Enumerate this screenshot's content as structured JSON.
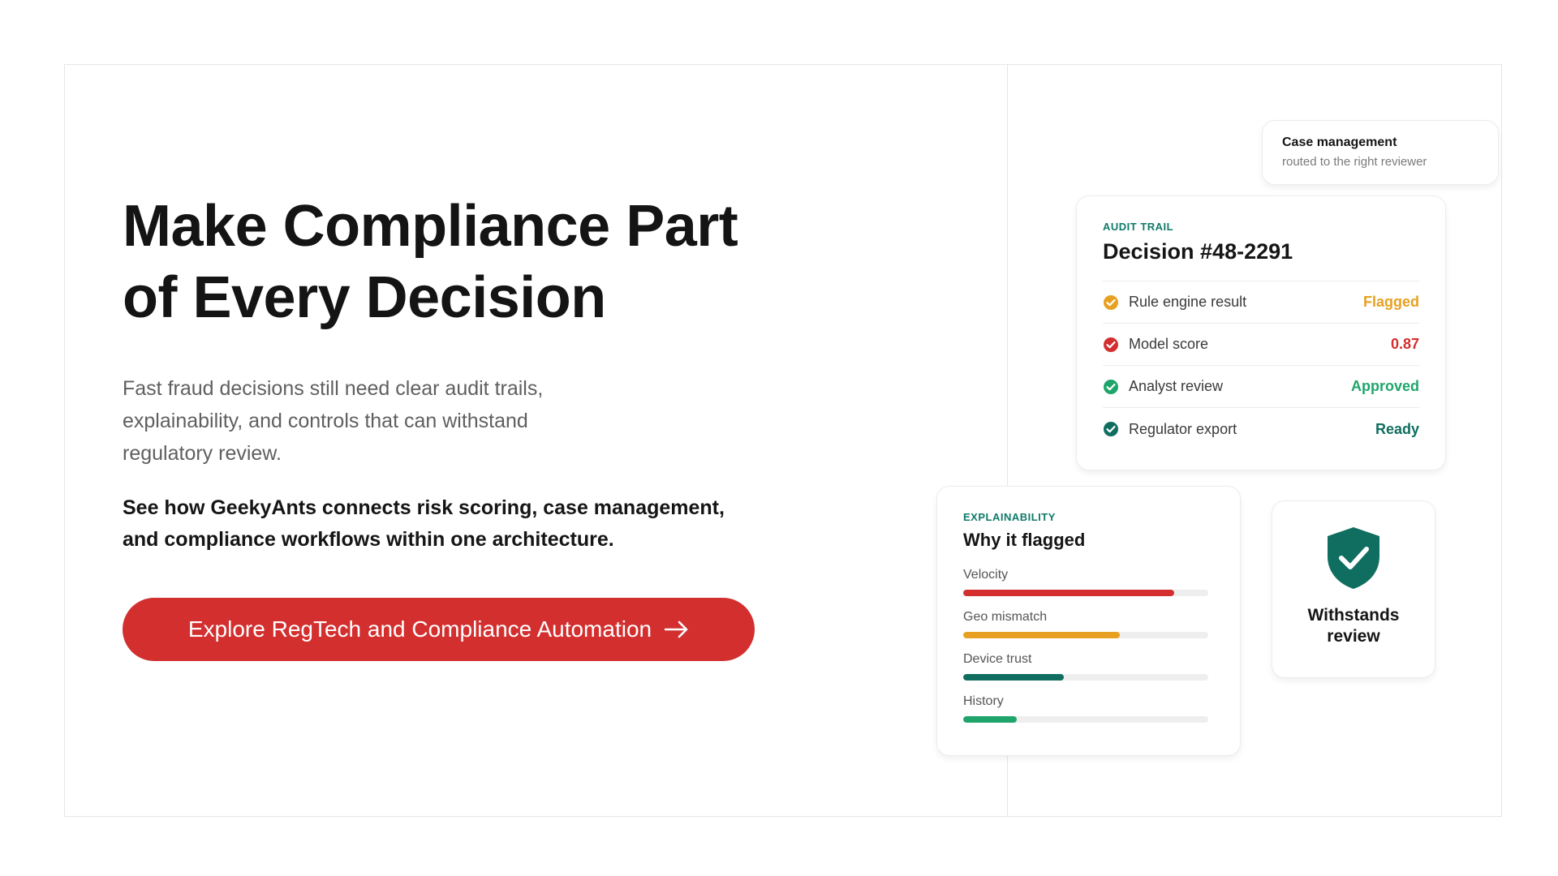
{
  "hero": {
    "title_line1": "Make Compliance Part",
    "title_line2": "of Every Decision",
    "description": "Fast fraud decisions still need clear audit trails, explainability, and controls that can withstand regulatory review.",
    "cta_text": "See how GeekyAnts connects risk scoring, case management, and compliance workflows within one architecture.",
    "button_label": "Explore RegTech and Compliance Automation",
    "button_color": "#d32f2f"
  },
  "case_card": {
    "title": "Case management",
    "subtitle": "routed to the right reviewer"
  },
  "audit_card": {
    "label": "AUDIT TRAIL",
    "title": "Decision #48-2291",
    "rows": [
      {
        "label": "Rule engine result",
        "value": "Flagged",
        "color": "#e8a020",
        "icon": "check-circle-icon"
      },
      {
        "label": "Model score",
        "value": "0.87",
        "color": "#d32f2f",
        "icon": "check-circle-icon"
      },
      {
        "label": "Analyst review",
        "value": "Approved",
        "color": "#1fa56b",
        "icon": "check-circle-icon"
      },
      {
        "label": "Regulator export",
        "value": "Ready",
        "color": "#0f6e60",
        "icon": "check-circle-icon"
      }
    ]
  },
  "explain_card": {
    "label": "EXPLAINABILITY",
    "title": "Why it flagged",
    "factors": [
      {
        "label": "Velocity",
        "level": 0.86,
        "color": "#d32f2f"
      },
      {
        "label": "Geo mismatch",
        "level": 0.64,
        "color": "#e8a020"
      },
      {
        "label": "Device trust",
        "level": 0.41,
        "color": "#0f6e60"
      },
      {
        "label": "History",
        "level": 0.22,
        "color": "#1fa56b"
      }
    ]
  },
  "shield_card": {
    "icon": "shield-check-icon",
    "caption": "Withstands review",
    "color": "#0f6e60"
  }
}
